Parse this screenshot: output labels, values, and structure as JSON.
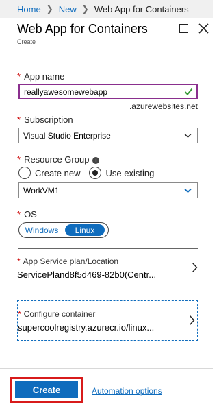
{
  "breadcrumb": {
    "items": [
      "Home",
      "New"
    ],
    "current": "Web App for Containers"
  },
  "header": {
    "title": "Web App for Containers",
    "subtitle": "Create"
  },
  "app_name": {
    "label": "App name",
    "value": "reallyawesomewebapp",
    "suffix": ".azurewebsites.net"
  },
  "subscription": {
    "label": "Subscription",
    "value": "Visual Studio Enterprise"
  },
  "resource_group": {
    "label": "Resource Group",
    "options": [
      "Create new",
      "Use existing"
    ],
    "selected": "Use existing",
    "value": "WorkVM1"
  },
  "os": {
    "label": "OS",
    "options": [
      "Windows",
      "Linux"
    ],
    "selected": "Linux"
  },
  "service_plan": {
    "label": "App Service plan/Location",
    "value": "ServicePland8f5d469-82b0(Centr..."
  },
  "container": {
    "label": "Configure container",
    "value": "supercoolregistry.azurecr.io/linux..."
  },
  "footer": {
    "create_label": "Create",
    "automation_label": "Automation options"
  },
  "colors": {
    "accent": "#0f6cbd",
    "required": "#cc0000",
    "valid_border": "#8a2f8e",
    "highlight": "#d81b1b"
  },
  "icons": [
    "maximize-icon",
    "close-icon",
    "check-icon",
    "info-icon",
    "chevron-down-icon",
    "chevron-right-icon"
  ]
}
